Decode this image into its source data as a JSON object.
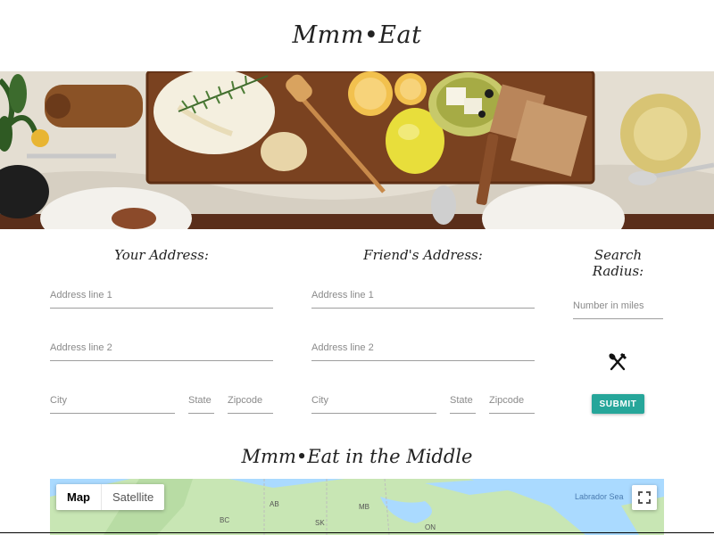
{
  "header": {
    "title": "Mmm•Eat"
  },
  "your_address": {
    "heading": "Your Address:",
    "line1_placeholder": "Address line 1",
    "line2_placeholder": "Address line 2",
    "city_placeholder": "City",
    "state_placeholder": "State",
    "zip_placeholder": "Zipcode"
  },
  "friend_address": {
    "heading": "Friend's Address:",
    "line1_placeholder": "Address line 1",
    "line2_placeholder": "Address line 2",
    "city_placeholder": "City",
    "state_placeholder": "State",
    "zip_placeholder": "Zipcode"
  },
  "search": {
    "heading_line1": "Search",
    "heading_line2": "Radius:",
    "radius_placeholder": "Number in miles",
    "submit_label": "SUBMIT",
    "icon": "fork-knife-icon"
  },
  "map_section": {
    "title": "Mmm•Eat in the Middle",
    "map_type_map": "Map",
    "map_type_satellite": "Satellite",
    "sea_label": "Labrador Sea",
    "region_labels": [
      "AB",
      "MB",
      "BC",
      "SK",
      "ON"
    ],
    "fullscreen_icon": "fullscreen-icon"
  },
  "colors": {
    "accent": "#26a69a",
    "water": "#aadaff",
    "land": "#c8e6b4"
  }
}
